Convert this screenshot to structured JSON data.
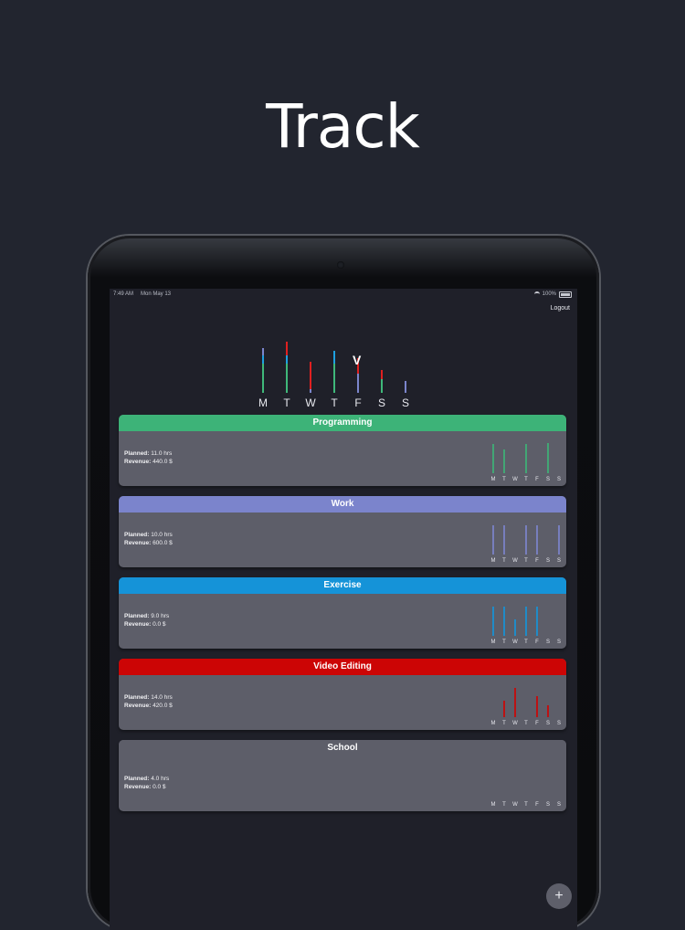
{
  "headline": "Track",
  "status_bar": {
    "time": "7:49 AM",
    "date": "Mon May 13",
    "battery": "100%"
  },
  "logout_label": "Logout",
  "weekly_chart": {
    "days": [
      "M",
      "T",
      "W",
      "T",
      "F",
      "S",
      "S"
    ],
    "selected_marker": "V",
    "colors": {
      "programming": "#3fb87a",
      "work": "#7b85cc",
      "exercise": "#1ea0e0",
      "video": "#e02020",
      "school": "#666666"
    },
    "stacks": [
      {
        "day": "M",
        "segments": [
          {
            "color": "#3fb87a",
            "h": 0.46
          },
          {
            "color": "#1ea0e0",
            "h": 0.12
          },
          {
            "color": "#7b85cc",
            "h": 0.12
          }
        ]
      },
      {
        "day": "T",
        "segments": [
          {
            "color": "#3fb87a",
            "h": 0.46
          },
          {
            "color": "#1ea0e0",
            "h": 0.12
          },
          {
            "color": "#e02020",
            "h": 0.22
          }
        ]
      },
      {
        "day": "W",
        "segments": [
          {
            "color": "#7b85cc",
            "h": 0.06
          },
          {
            "color": "#e02020",
            "h": 0.42
          }
        ]
      },
      {
        "day": "T",
        "segments": [
          {
            "color": "#3fb87a",
            "h": 0.46
          },
          {
            "color": "#1ea0e0",
            "h": 0.2
          }
        ]
      },
      {
        "day": "F",
        "segments": [
          {
            "color": "#7b85cc",
            "h": 0.3
          },
          {
            "color": "#e02020",
            "h": 0.24
          }
        ]
      },
      {
        "day": "S",
        "segments": [
          {
            "color": "#3fb87a",
            "h": 0.22
          },
          {
            "color": "#e02020",
            "h": 0.14
          }
        ]
      },
      {
        "day": "S",
        "segments": [
          {
            "color": "#7b85cc",
            "h": 0.18
          }
        ]
      }
    ]
  },
  "categories": [
    {
      "name": "Programming",
      "color": "#3db378",
      "planned_label": "Planned:",
      "planned": "11.0 hrs",
      "revenue_label": "Revenue:",
      "revenue": "440.0 $",
      "bars": [
        0.72,
        0.58,
        0.0,
        0.72,
        0.0,
        0.76,
        0.0
      ]
    },
    {
      "name": "Work",
      "color": "#7b84cc",
      "planned_label": "Planned:",
      "planned": "10.0 hrs",
      "revenue_label": "Revenue:",
      "revenue": "600.0 $",
      "bars": [
        0.72,
        0.72,
        0.0,
        0.72,
        0.72,
        0.0,
        0.72
      ]
    },
    {
      "name": "Exercise",
      "color": "#1593d8",
      "planned_label": "Planned:",
      "planned": "9.0 hrs",
      "revenue_label": "Revenue:",
      "revenue": "0.0 $",
      "bars": [
        0.72,
        0.72,
        0.4,
        0.72,
        0.72,
        0.0,
        0.0
      ]
    },
    {
      "name": "Video Editing",
      "color": "#cc0505",
      "planned_label": "Planned:",
      "planned": "14.0 hrs",
      "revenue_label": "Revenue:",
      "revenue": "420.0 $",
      "bars": [
        0.0,
        0.4,
        0.72,
        0.0,
        0.52,
        0.3,
        0.0
      ]
    },
    {
      "name": "School",
      "color": "#5d5e69",
      "planned_label": "Planned:",
      "planned": "4.0 hrs",
      "revenue_label": "Revenue:",
      "revenue": "0.0 $",
      "bars": [
        0,
        0,
        0,
        0,
        0,
        0,
        0
      ]
    }
  ],
  "fab_label": "+"
}
